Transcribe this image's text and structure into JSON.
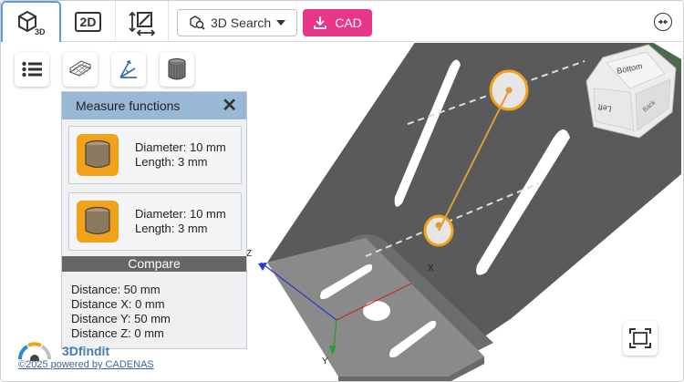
{
  "toolbar": {
    "tab_3d_label": "3D",
    "tab_2d_label": "2D",
    "search_label": "3D Search",
    "cad_label": "CAD"
  },
  "panel": {
    "title": "Measure functions",
    "items": [
      {
        "diameter": "Diameter: 10 mm",
        "length": "Length: 3 mm"
      },
      {
        "diameter": "Diameter: 10 mm",
        "length": "Length: 3 mm"
      }
    ],
    "compare_label": "Compare",
    "distances": [
      "Distance: 50 mm",
      "Distance X: 0 mm",
      "Distance Y: 50 mm",
      "Distance Z: 0 mm"
    ]
  },
  "viewcube": {
    "faces": [
      "Bottom",
      "Left",
      "Back"
    ]
  },
  "axes": {
    "x": "X",
    "y": "Y",
    "z": "Z"
  },
  "brand": {
    "name": "3Dfindit",
    "copyright": "©2025 powered by CADENAS"
  },
  "colors": {
    "accent_pink": "#e8378a",
    "panel_header": "#98b8d5",
    "cylinder_orange": "#f2a21a",
    "tab_border": "#5aa0d8",
    "part_gray": "#5a5a5a"
  },
  "icons": {
    "tab_3d": "cube-icon",
    "tab_measure": "measure-resize-icon",
    "search": "3d-search-icon",
    "search_dropdown": "caret-down-icon",
    "cad": "download-icon",
    "collapse": "collapse-arrows-icon",
    "menu": "list-menu-icon",
    "wireframe": "wireframe-icon",
    "axis": "axis-measure-icon",
    "shaded": "shaded-cylinder-icon",
    "close": "close-icon",
    "cylinder": "cylinder-icon",
    "fit": "fit-to-screen-icon",
    "gauge": "gauge-logo-icon"
  }
}
